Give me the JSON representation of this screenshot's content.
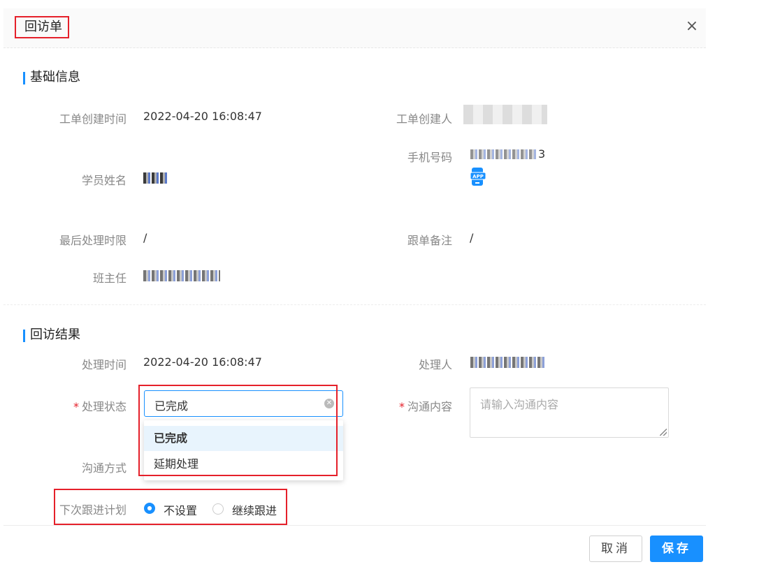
{
  "dialog": {
    "title": "回访单",
    "close_icon": "×"
  },
  "basic": {
    "section_title": "基础信息",
    "created_time_label": "工单创建时间",
    "created_time": "2022-04-20 16:08:47",
    "creator_label": "工单创建人",
    "phone_label": "手机号码",
    "phone_suffix": "3",
    "student_label": "学员姓名",
    "deadline_label": "最后处理时限",
    "deadline": "/",
    "note_label": "跟单备注",
    "note": "/",
    "teacher_label": "班主任",
    "app_badge": "APP"
  },
  "result": {
    "section_title": "回访结果",
    "handle_time_label": "处理时间",
    "handle_time": "2022-04-20 16:08:47",
    "handler_label": "处理人",
    "status_label": "处理状态",
    "status_value": "已完成",
    "status_options": [
      "已完成",
      "延期处理"
    ],
    "content_label": "沟通内容",
    "content_placeholder": "请输入沟通内容",
    "method_label": "沟通方式",
    "plan_label": "下次跟进计划",
    "plan_options": [
      "不设置",
      "继续跟进"
    ],
    "required_mark": "*"
  },
  "footer": {
    "cancel": "取消",
    "save": "保存"
  }
}
